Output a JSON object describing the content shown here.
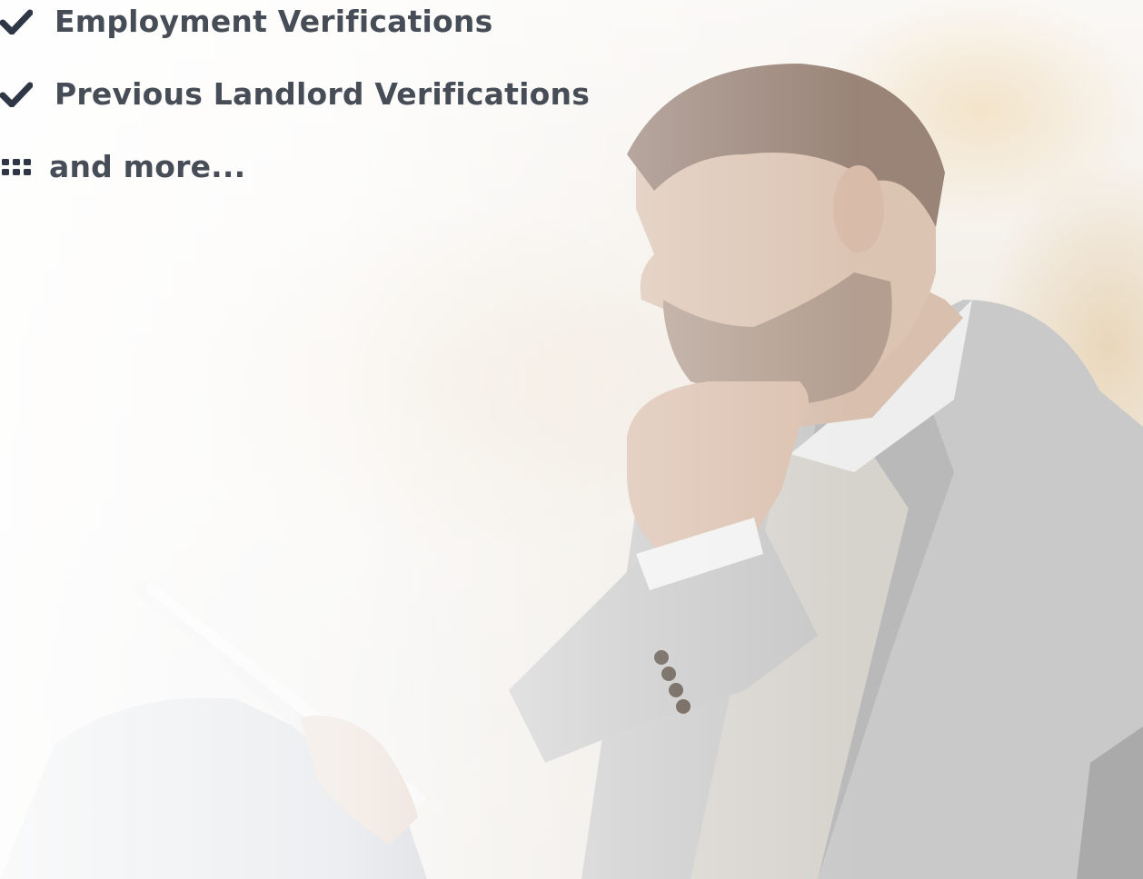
{
  "features": [
    {
      "icon": "check-icon",
      "label": "Employment Verifications"
    },
    {
      "icon": "check-icon",
      "label": "Previous Landlord Verifications"
    },
    {
      "icon": "grid-icon",
      "label": "and more..."
    }
  ],
  "colors": {
    "text": "#474d57",
    "icon": "#2f3746",
    "background": "#f6f3ef"
  }
}
